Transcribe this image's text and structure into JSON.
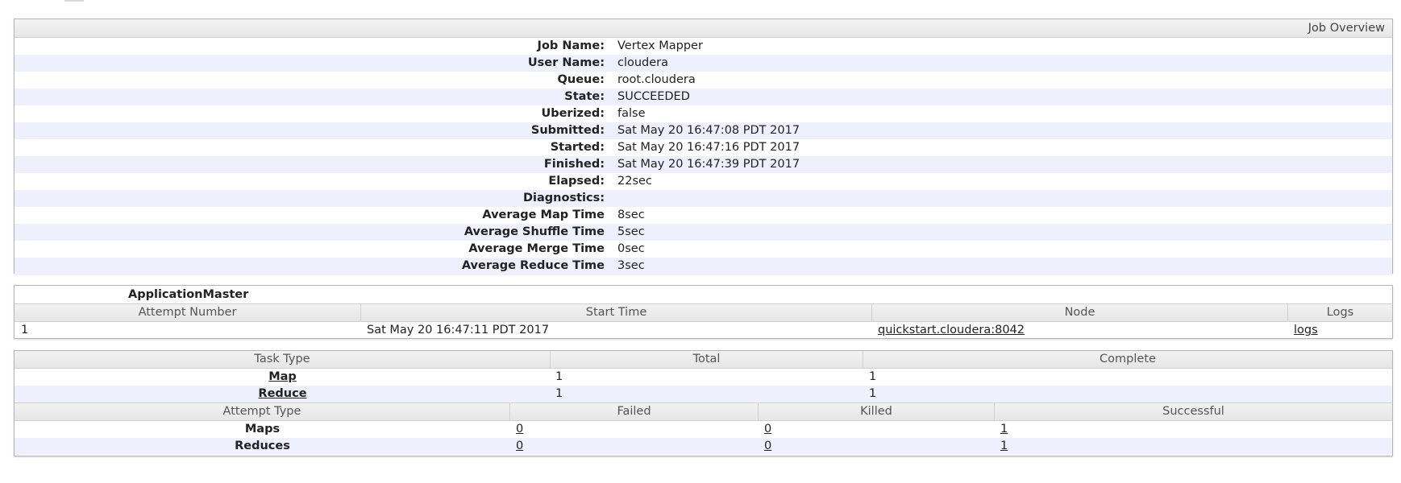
{
  "overview": {
    "header": "Job Overview",
    "rows": [
      {
        "label": "Job Name:",
        "value": "Vertex Mapper"
      },
      {
        "label": "User Name:",
        "value": "cloudera"
      },
      {
        "label": "Queue:",
        "value": "root.cloudera"
      },
      {
        "label": "State:",
        "value": "SUCCEEDED"
      },
      {
        "label": "Uberized:",
        "value": "false"
      },
      {
        "label": "Submitted:",
        "value": "Sat May 20 16:47:08 PDT 2017"
      },
      {
        "label": "Started:",
        "value": "Sat May 20 16:47:16 PDT 2017"
      },
      {
        "label": "Finished:",
        "value": "Sat May 20 16:47:39 PDT 2017"
      },
      {
        "label": "Elapsed:",
        "value": "22sec"
      },
      {
        "label": "Diagnostics:",
        "value": ""
      },
      {
        "label": "Average Map Time",
        "value": "8sec"
      },
      {
        "label": "Average Shuffle Time",
        "value": "5sec"
      },
      {
        "label": "Average Merge Time",
        "value": "0sec"
      },
      {
        "label": "Average Reduce Time",
        "value": "3sec"
      }
    ]
  },
  "app_master": {
    "title": "ApplicationMaster",
    "columns": [
      "Attempt Number",
      "Start Time",
      "Node",
      "Logs"
    ],
    "row": {
      "attempt": "1",
      "start_time": "Sat May 20 16:47:11 PDT 2017",
      "node": "quickstart.cloudera:8042",
      "logs": "logs"
    }
  },
  "tasks": {
    "columns": [
      "Task Type",
      "Total",
      "Complete"
    ],
    "rows": [
      {
        "type": "Map",
        "total": "1",
        "complete": "1"
      },
      {
        "type": "Reduce",
        "total": "1",
        "complete": "1"
      }
    ],
    "attempt_columns": [
      "Attempt Type",
      "Failed",
      "Killed",
      "Successful"
    ],
    "attempt_rows": [
      {
        "type": "Maps",
        "failed": "0",
        "killed": "0",
        "successful": "1"
      },
      {
        "type": "Reduces",
        "failed": "0",
        "killed": "0",
        "successful": "1"
      }
    ]
  }
}
